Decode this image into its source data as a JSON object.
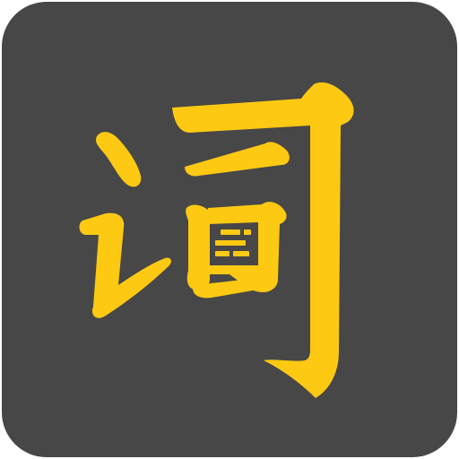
{
  "app_icon": {
    "character": "词",
    "background_color": "#474747",
    "glyph_color": "#FDC913"
  }
}
